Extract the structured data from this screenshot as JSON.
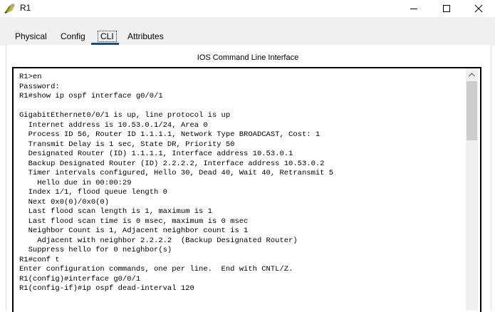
{
  "window": {
    "title": "R1",
    "icon": "router-icon",
    "controls": [
      "minimize-icon",
      "maximize-icon",
      "close-icon"
    ]
  },
  "tabs": [
    {
      "label": "Physical"
    },
    {
      "label": "Config"
    },
    {
      "label": "CLI",
      "selected": true
    },
    {
      "label": "Attributes"
    }
  ],
  "panel": {
    "header": "IOS Command Line Interface"
  },
  "console": {
    "lines": [
      "R1>en",
      "Password:",
      "R1#show ip ospf interface g0/0/1",
      "",
      "GigabitEthernet0/0/1 is up, line protocol is up",
      "  Internet address is 10.53.0.1/24, Area 0",
      "  Process ID 56, Router ID 1.1.1.1, Network Type BROADCAST, Cost: 1",
      "  Transmit Delay is 1 sec, State DR, Priority 50",
      "  Designated Router (ID) 1.1.1.1, Interface address 10.53.0.1",
      "  Backup Designated Router (ID) 2.2.2.2, Interface address 10.53.0.2",
      "  Timer intervals configured, Hello 30, Dead 40, Wait 40, Retransmit 5",
      "    Hello due in 00:00:29",
      "  Index 1/1, flood queue length 0",
      "  Next 0x0(0)/0x0(0)",
      "  Last flood scan length is 1, maximum is 1",
      "  Last flood scan time is 0 msec, maximum is 0 msec",
      "  Neighbor Count is 1, Adjacent neighbor count is 1",
      "    Adjacent with neighbor 2.2.2.2  (Backup Designated Router)",
      "  Suppress hello for 0 neighbor(s)",
      "R1#conf t",
      "Enter configuration commands, one per line.  End with CNTL/Z.",
      "R1(config)#interface g0/0/1",
      "R1(config-if)#ip ospf dead-interval 120"
    ]
  },
  "colors": {
    "tab_underline": "#1f4e79",
    "background": "#f0f0f0",
    "console_border": "#000000"
  }
}
